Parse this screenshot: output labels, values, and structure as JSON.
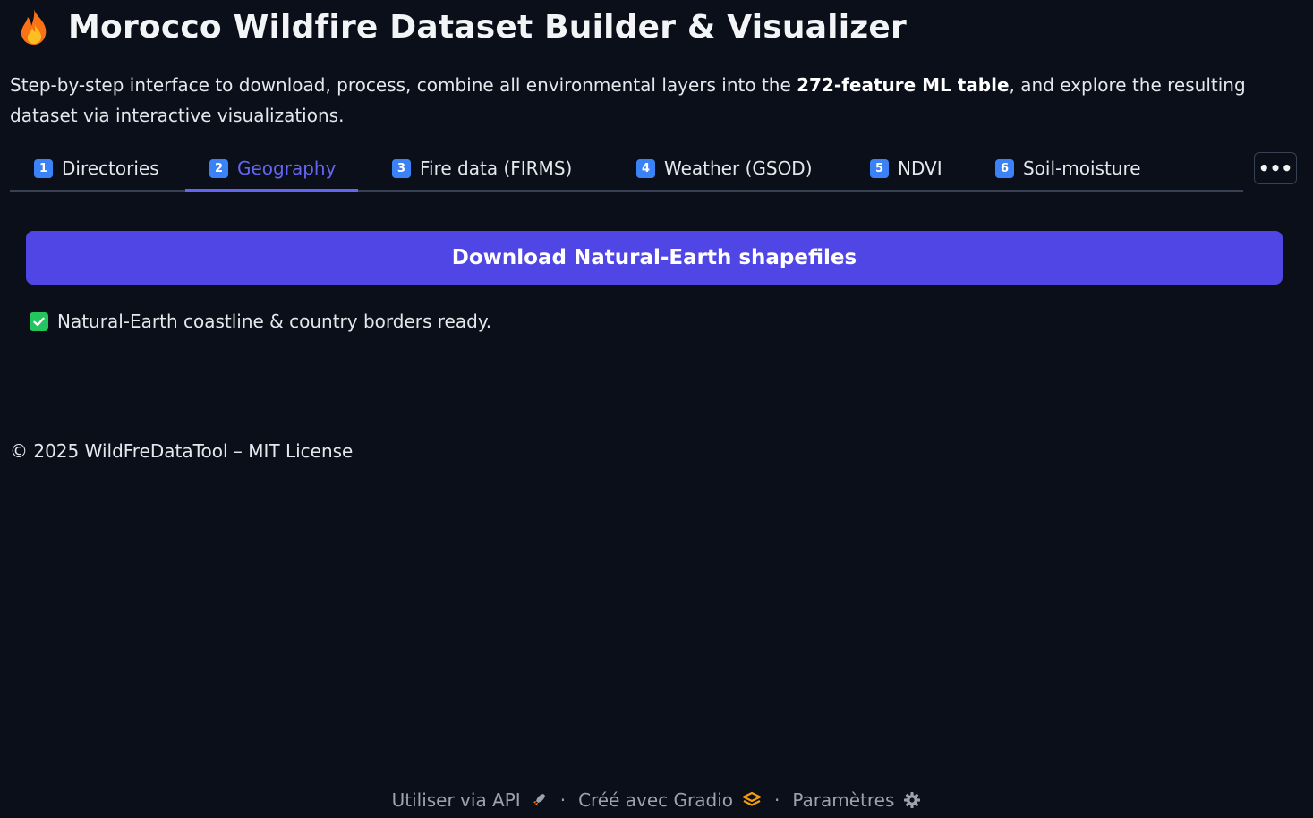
{
  "header": {
    "icon": "flame-icon",
    "title": "Morocco Wildfire Dataset Builder & Visualizer"
  },
  "subtitle": {
    "before": "Step-by-step interface to download, process, combine all environmental layers into the ",
    "bold": "272-feature ML table",
    "after": ", and explore the resulting dataset via interactive visualizations."
  },
  "tabs": [
    {
      "num": "1",
      "label": "Directories"
    },
    {
      "num": "2",
      "label": "Geography"
    },
    {
      "num": "3",
      "label": "Fire data (FIRMS)"
    },
    {
      "num": "4",
      "label": "Weather (GSOD)"
    },
    {
      "num": "5",
      "label": "NDVI"
    },
    {
      "num": "6",
      "label": "Soil-moisture"
    }
  ],
  "active_tab": "Geography",
  "more_button": "•••",
  "geography": {
    "download_button": "Download Natural-Earth shapefiles",
    "status_icon": "check-icon",
    "status_text": "Natural-Earth coastline & country borders ready."
  },
  "copyright": "© 2025 WildFreDataTool – MIT License",
  "footer": {
    "api_label": "Utiliser via API",
    "api_icon": "rocket-icon",
    "separator": "·",
    "gradio_label": "Créé avec Gradio",
    "gradio_icon": "gradio-logo-icon",
    "settings_label": "Paramètres",
    "settings_icon": "gear-icon"
  },
  "colors": {
    "background": "#0b0f19",
    "accent": "#6366f1",
    "primary_button": "#4f46e5",
    "tab_number_badge": "#3b82f6",
    "check": "#22c55e"
  }
}
